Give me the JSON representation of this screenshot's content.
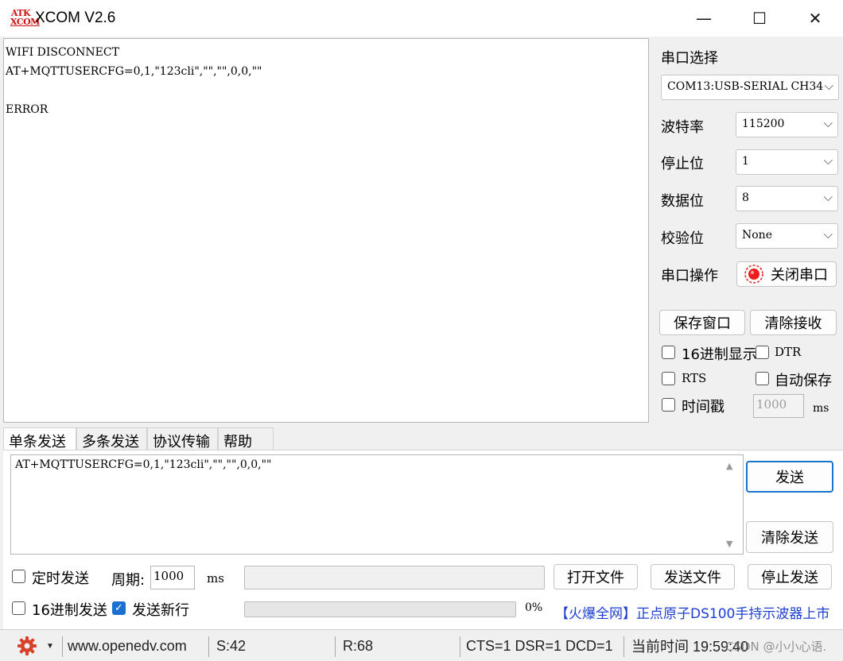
{
  "window": {
    "logo_line1": "ATK",
    "logo_line2": "XCOM",
    "title": "XCOM V2.6",
    "minimize_glyph": "—",
    "maximize_glyph": "☐",
    "close_glyph": "✕"
  },
  "receive": {
    "text": "WIFI DISCONNECT\nAT+MQTTUSERCFG=0,1,\"123cli\",\"\",\"\",0,0,\"\"\n\nERROR"
  },
  "settings": {
    "port_label": "串口选择",
    "port_value": "COM13:USB-SERIAL CH34",
    "baud_label": "波特率",
    "baud_value": "115200",
    "stopbits_label": "停止位",
    "stopbits_value": "1",
    "databits_label": "数据位",
    "databits_value": "8",
    "parity_label": "校验位",
    "parity_value": "None",
    "operation_label": "串口操作",
    "close_port_label": "关闭串口",
    "dropdown_arrow": "⌵"
  },
  "receive_buttons": {
    "save_window": "保存窗口",
    "clear_receive": "清除接收"
  },
  "receive_options": {
    "hex_display": "16进制显示",
    "dtr": "DTR",
    "rts": "RTS",
    "auto_save": "自动保存",
    "timestamp": "时间戳",
    "timestamp_value": "1000",
    "timestamp_unit": "ms"
  },
  "tabs": [
    {
      "label": "单条发送"
    },
    {
      "label": "多条发送"
    },
    {
      "label": "协议传输"
    },
    {
      "label": "帮助"
    }
  ],
  "send": {
    "text": "AT+MQTTUSERCFG=0,1,\"123cli\",\"\",\"\",0,0,\"\"",
    "send_button": "发送",
    "clear_send_button": "清除发送",
    "scroll_up": "▲",
    "scroll_down": "▼"
  },
  "send_options": {
    "timed_send": "定时发送",
    "period_label": "周期:",
    "period_value": "1000",
    "period_unit": "ms",
    "hex_send": "16进制发送",
    "send_newline": "发送新行",
    "send_newline_checked": true,
    "open_file": "打开文件",
    "send_file": "发送文件",
    "stop_send": "停止发送",
    "progress_percent": "0%",
    "progress_fraction": 0
  },
  "promo": {
    "text": "【火爆全网】正点原子DS100手持示波器上市"
  },
  "statusbar": {
    "website": "www.openedv.com",
    "sent": "S:42",
    "received": "R:68",
    "lines": "CTS=1 DSR=1 DCD=1",
    "time": "当前时间 19:59:40",
    "watermark": "CSDN @小小心语."
  },
  "colors": {
    "accent": "#1a73c8",
    "promo_text": "#1c3ed1",
    "logo_red": "#d01010",
    "gear_red": "#d8412a"
  },
  "icons": {
    "gear": "gear-icon",
    "record": "record-icon",
    "dropdown": "chevron-down-icon",
    "check": "checkmark-icon"
  }
}
